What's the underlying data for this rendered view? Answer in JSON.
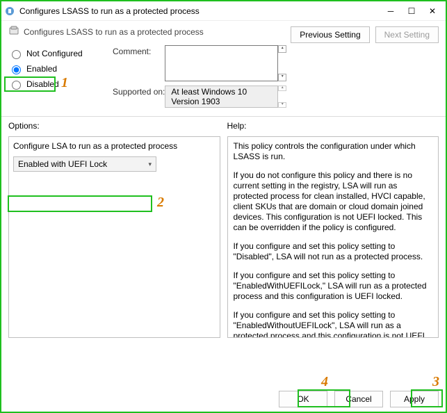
{
  "window": {
    "title": "Configures LSASS to run as a protected process"
  },
  "header": {
    "title": "Configures LSASS to run as a protected process"
  },
  "nav": {
    "prev": "Previous Setting",
    "next": "Next Setting"
  },
  "radios": {
    "not_configured": "Not Configured",
    "enabled": "Enabled",
    "disabled": "Disabled"
  },
  "fields": {
    "comment_label": "Comment:",
    "comment_value": "",
    "supported_label": "Supported on:",
    "supported_value": "At least Windows 10 Version 1903"
  },
  "columns": {
    "options": "Options:",
    "help": "Help:"
  },
  "options": {
    "desc": "Configure LSA to run as a protected process",
    "selected": "Enabled with UEFI Lock"
  },
  "help": {
    "p1": "This policy controls the configuration under which LSASS is run.",
    "p2": "If you do not configure this policy and there is no current setting in the registry, LSA will run as protected process for clean installed, HVCI capable, client SKUs that are domain or cloud domain joined devices. This configuration is not UEFI locked. This can be overridden if the policy is configured.",
    "p3": "If you configure and set this policy setting to \"Disabled\", LSA will not run as a protected process.",
    "p4": "If you configure and set this policy setting to \"EnabledWithUEFILock,\" LSA will run as a protected process and this configuration is UEFI locked.",
    "p5": "If you configure and set this policy setting to \"EnabledWithoutUEFILock\", LSA will run as a protected process and this configuration is not UEFI locked."
  },
  "buttons": {
    "ok": "OK",
    "cancel": "Cancel",
    "apply": "Apply"
  },
  "annotations": {
    "n1": "1",
    "n2": "2",
    "n3": "3",
    "n4": "4"
  }
}
